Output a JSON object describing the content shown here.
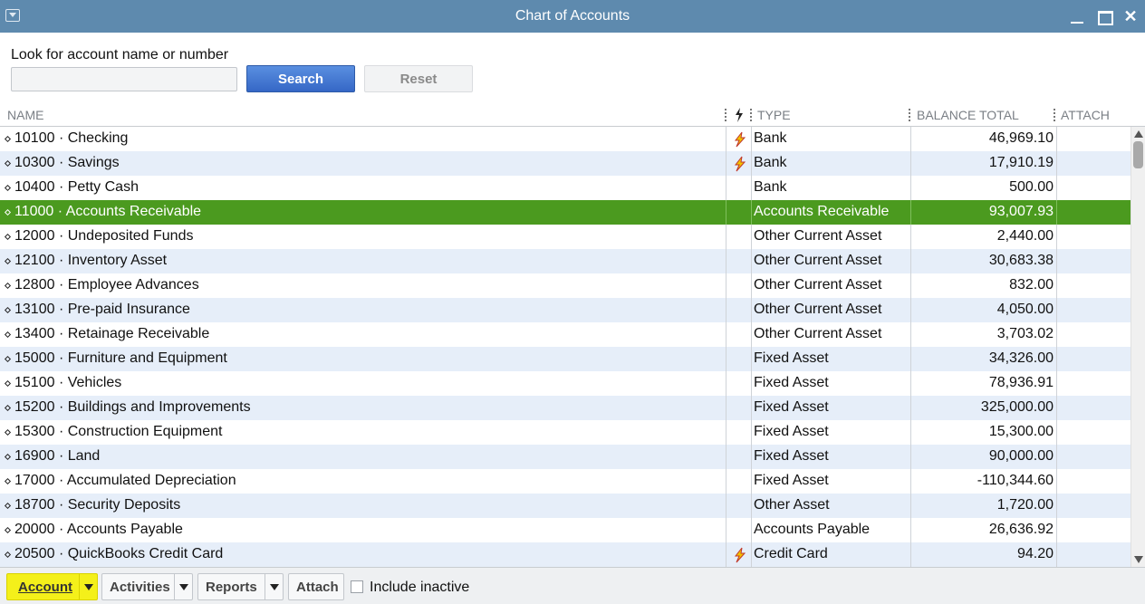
{
  "window": {
    "title": "Chart of Accounts"
  },
  "search": {
    "label": "Look for account name or number",
    "value": "",
    "placeholder": "",
    "search_label": "Search",
    "reset_label": "Reset"
  },
  "columns": {
    "name": "NAME",
    "type": "TYPE",
    "balance": "BALANCE TOTAL",
    "attach": "ATTACH"
  },
  "colors": {
    "selected_row": "#4b9a1f",
    "alt_row": "#e6eef9",
    "title_bar": "#5e8aae",
    "highlight": "#f4f01a",
    "online_flag": "#f2c200"
  },
  "accounts": [
    {
      "name": "10100 · Checking",
      "online": true,
      "type": "Bank",
      "balance": "46,969.10"
    },
    {
      "name": "10300 · Savings",
      "online": true,
      "type": "Bank",
      "balance": "17,910.19"
    },
    {
      "name": "10400 · Petty Cash",
      "online": false,
      "type": "Bank",
      "balance": "500.00"
    },
    {
      "name": "11000 · Accounts Receivable",
      "online": false,
      "type": "Accounts Receivable",
      "balance": "93,007.93",
      "selected": true
    },
    {
      "name": "12000 · Undeposited Funds",
      "online": false,
      "type": "Other Current Asset",
      "balance": "2,440.00"
    },
    {
      "name": "12100 · Inventory Asset",
      "online": false,
      "type": "Other Current Asset",
      "balance": "30,683.38"
    },
    {
      "name": "12800 · Employee Advances",
      "online": false,
      "type": "Other Current Asset",
      "balance": "832.00"
    },
    {
      "name": "13100 · Pre-paid Insurance",
      "online": false,
      "type": "Other Current Asset",
      "balance": "4,050.00"
    },
    {
      "name": "13400 · Retainage Receivable",
      "online": false,
      "type": "Other Current Asset",
      "balance": "3,703.02"
    },
    {
      "name": "15000 · Furniture and Equipment",
      "online": false,
      "type": "Fixed Asset",
      "balance": "34,326.00"
    },
    {
      "name": "15100 · Vehicles",
      "online": false,
      "type": "Fixed Asset",
      "balance": "78,936.91"
    },
    {
      "name": "15200 · Buildings and Improvements",
      "online": false,
      "type": "Fixed Asset",
      "balance": "325,000.00"
    },
    {
      "name": "15300 · Construction Equipment",
      "online": false,
      "type": "Fixed Asset",
      "balance": "15,300.00"
    },
    {
      "name": "16900 · Land",
      "online": false,
      "type": "Fixed Asset",
      "balance": "90,000.00"
    },
    {
      "name": "17000 · Accumulated Depreciation",
      "online": false,
      "type": "Fixed Asset",
      "balance": "-110,344.60"
    },
    {
      "name": "18700 · Security Deposits",
      "online": false,
      "type": "Other Asset",
      "balance": "1,720.00"
    },
    {
      "name": "20000 · Accounts Payable",
      "online": false,
      "type": "Accounts Payable",
      "balance": "26,636.92"
    },
    {
      "name": "20500 · QuickBooks Credit Card",
      "online": true,
      "type": "Credit Card",
      "balance": "94.20"
    }
  ],
  "toolbar": {
    "account_label": "Account",
    "activities_label": "Activities",
    "reports_label": "Reports",
    "attach_label": "Attach",
    "include_inactive_label": "Include inactive",
    "include_inactive_checked": false
  }
}
